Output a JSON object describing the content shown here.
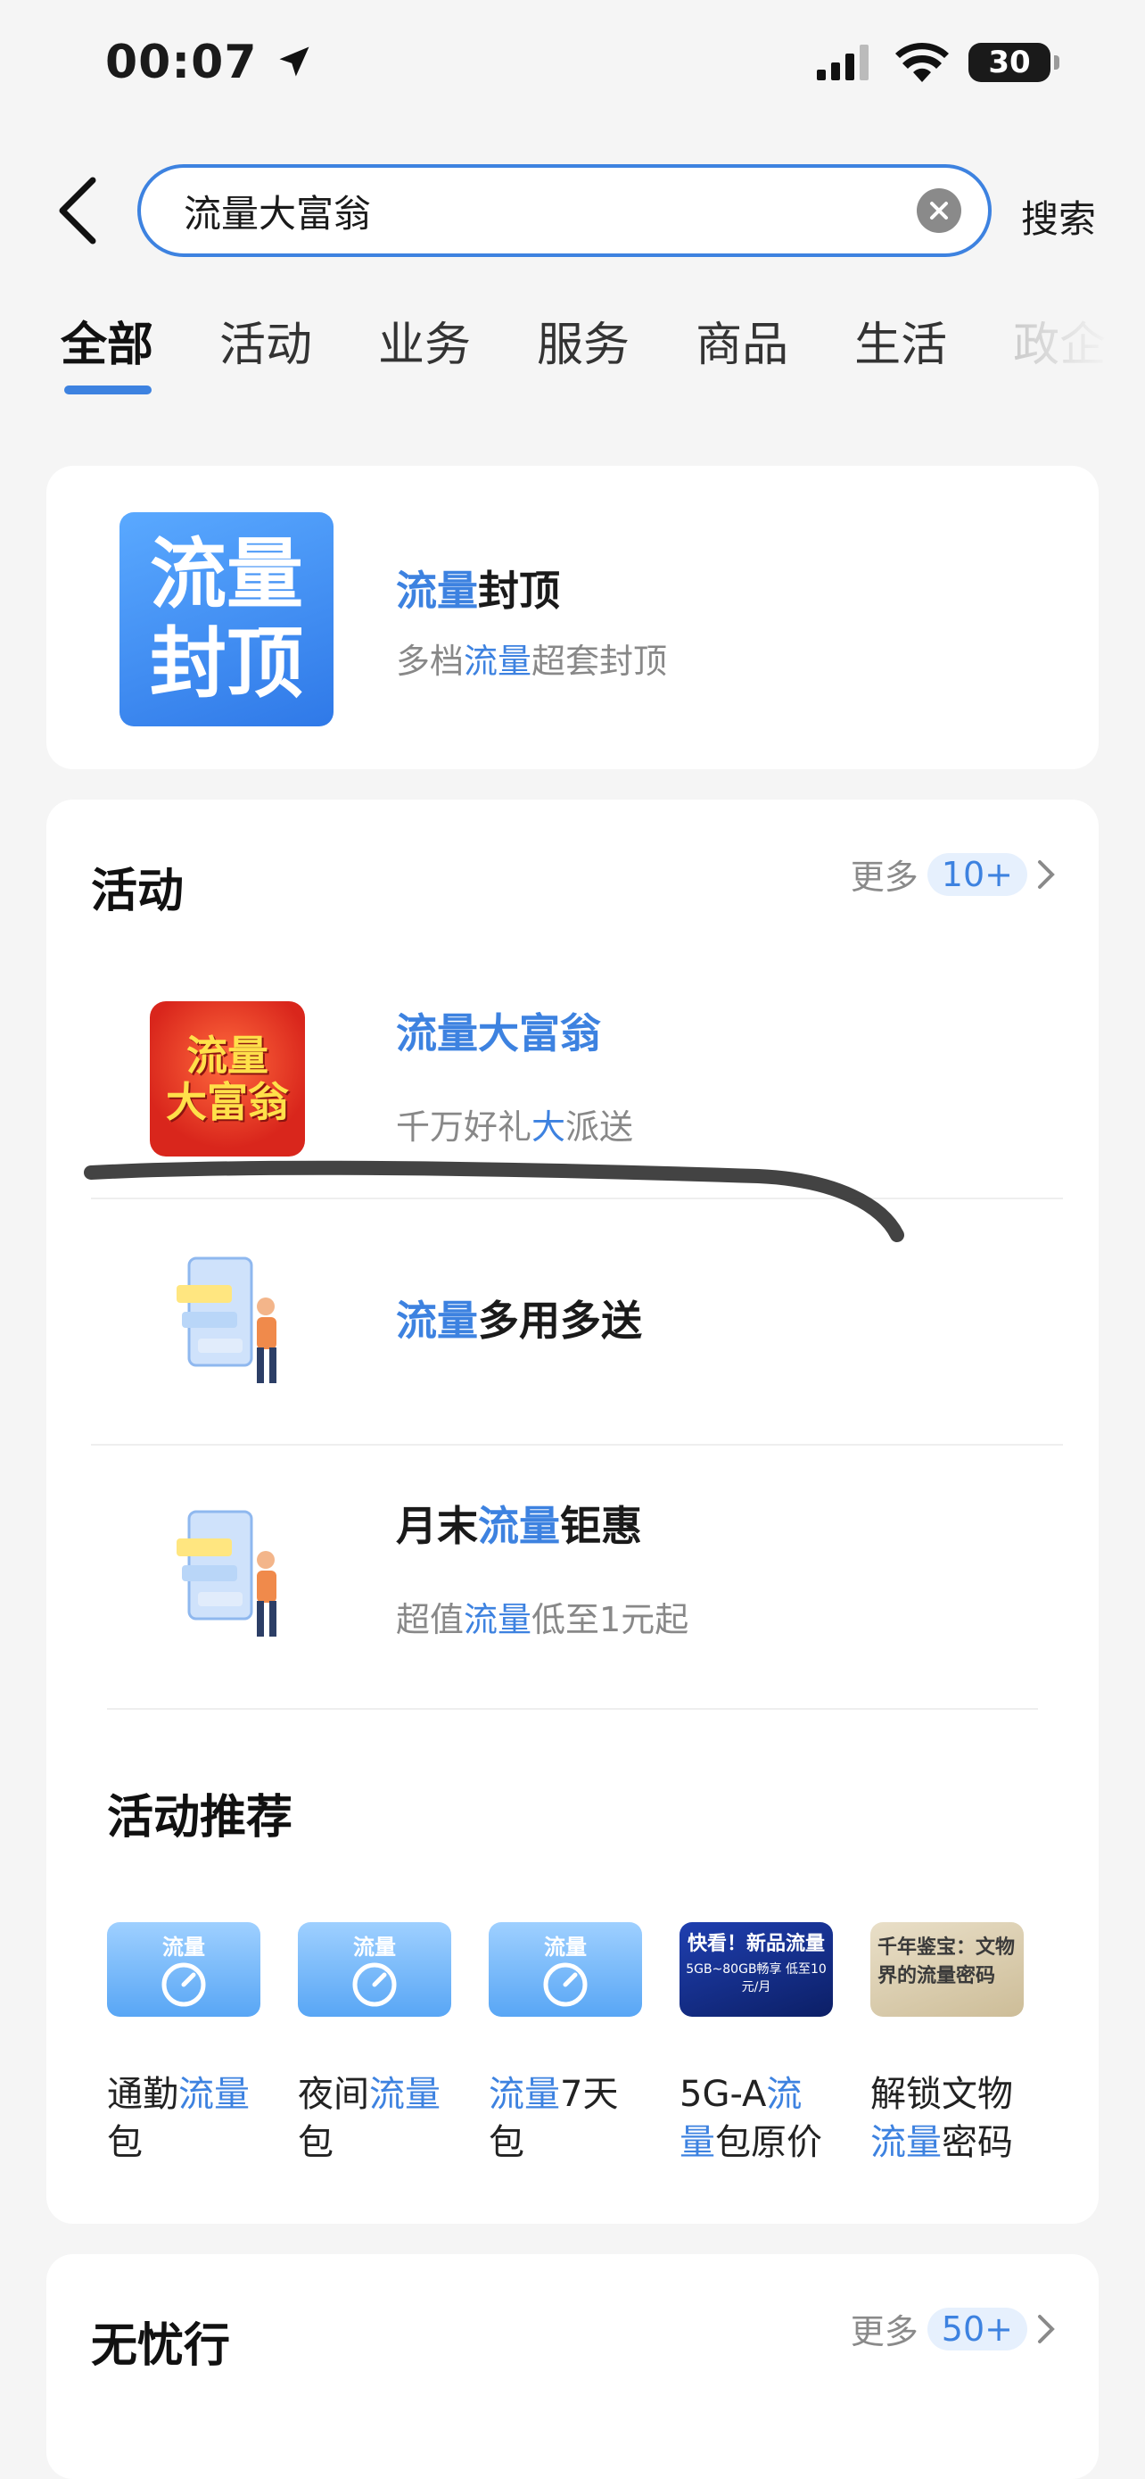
{
  "status_bar": {
    "time": "00:07",
    "battery": "30"
  },
  "search": {
    "value": "流量大富翁",
    "button_label": "搜索"
  },
  "tabs": [
    "全部",
    "活动",
    "业务",
    "服务",
    "商品",
    "生活",
    "政企"
  ],
  "top_result": {
    "logo_text": [
      "流量",
      "封顶"
    ],
    "title_hl": "流量",
    "title_rest": "封顶",
    "sub_pre": "多档",
    "sub_hl": "流量",
    "sub_post": "超套封顶"
  },
  "activities": {
    "title": "活动",
    "more_label": "更多",
    "more_count": "10+",
    "items": [
      {
        "thumb_text": [
          "流量",
          "大富翁"
        ],
        "title_hl": "流量大富翁",
        "sub_pre": "千万好礼",
        "sub_hl": "大",
        "sub_post": "派送"
      },
      {
        "title_hl": "流量",
        "title_rest": "多用多送"
      },
      {
        "title_pre": "月末",
        "title_hl": "流量",
        "title_rest": "钜惠",
        "sub_pre": "超值",
        "sub_hl": "流量",
        "sub_post": "低至1元起"
      }
    ]
  },
  "recommend": {
    "title": "活动推荐",
    "items": [
      {
        "img_text": "流量",
        "l1_pre": "通勤",
        "l1_hl": "流量",
        "l2": "包"
      },
      {
        "img_text": "流量",
        "l1_pre": "夜间",
        "l1_hl": "流量",
        "l2": "包"
      },
      {
        "img_text": "流量",
        "l1_hl": "流量",
        "l1_post": "7天",
        "l2": "包"
      },
      {
        "img_text": "快看！新品流量",
        "img_sub": "5GB~80GB畅享 低至10元/月",
        "l1_pre": "5G-A",
        "l1_hl": "流",
        "l2_hl": "量",
        "l2_post": "包原价"
      },
      {
        "img_text": "千年鉴宝：文物界的流量密码",
        "l1_pre": "解锁文物",
        "l2_hl": "流量",
        "l2_post": "密码"
      }
    ]
  },
  "worry_free": {
    "title": "无忧行",
    "more_label": "更多",
    "more_count": "50+"
  }
}
